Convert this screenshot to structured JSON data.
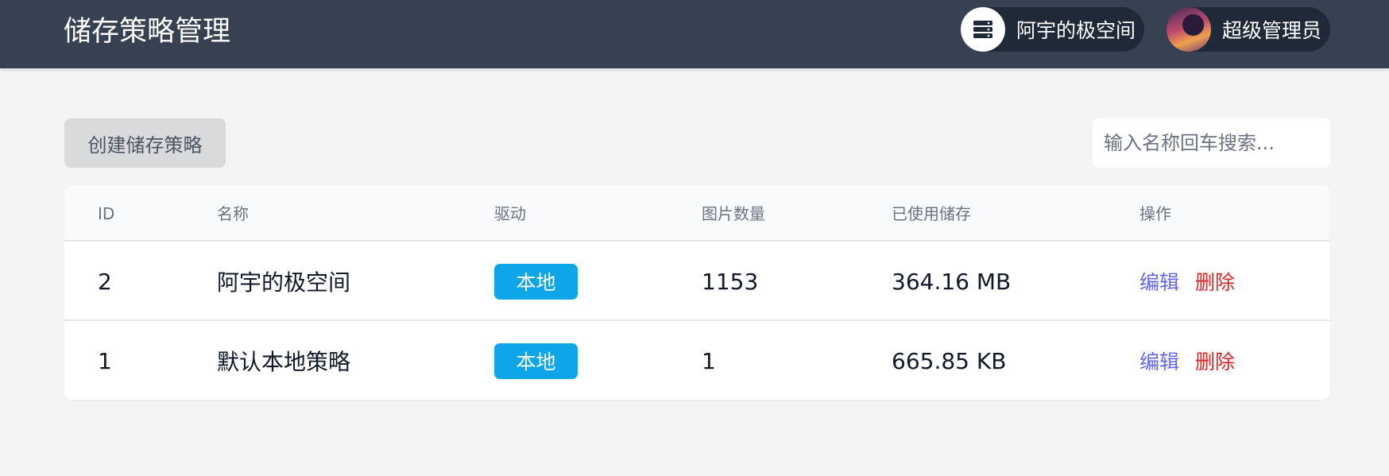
{
  "header": {
    "title": "储存策略管理",
    "storage_name": "阿宇的极空间",
    "storage_icon": "server-icon",
    "user_name": "超级管理员"
  },
  "toolbar": {
    "create_label": "创建储存策略",
    "search_placeholder": "输入名称回车搜索..."
  },
  "table": {
    "columns": [
      "ID",
      "名称",
      "驱动",
      "图片数量",
      "已使用储存",
      "操作"
    ],
    "rows": [
      {
        "id": "2",
        "name": "阿宇的极空间",
        "driver": "本地",
        "count": "1153",
        "used": "364.16 MB",
        "edit": "编辑",
        "delete": "删除"
      },
      {
        "id": "1",
        "name": "默认本地策略",
        "driver": "本地",
        "count": "1",
        "used": "665.85 KB",
        "edit": "编辑",
        "delete": "删除"
      }
    ]
  },
  "colors": {
    "topbar": "#374151",
    "badge": "#0ea5e9",
    "edit": "#6366f1",
    "delete": "#dc2626"
  }
}
